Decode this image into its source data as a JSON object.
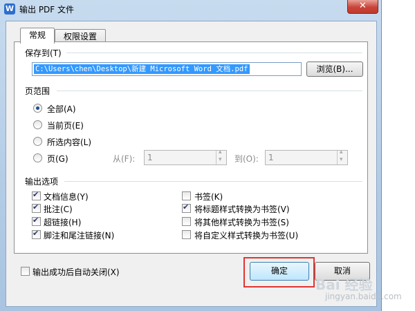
{
  "window": {
    "title": "输出 PDF 文件",
    "app_icon": "W",
    "close_glyph": "✕"
  },
  "tabs": [
    {
      "label": "常规"
    },
    {
      "label": "权限设置"
    }
  ],
  "save_to": {
    "label": "保存到(T)",
    "path": "C:\\Users\\chen\\Desktop\\新建 Microsoft Word 文档.pdf",
    "browse_label": "浏览(B)..."
  },
  "page_range": {
    "label": "页范围",
    "options": [
      {
        "label": "全部(A)",
        "checked": true
      },
      {
        "label": "当前页(E)",
        "checked": false
      },
      {
        "label": "所选内容(L)",
        "checked": false
      },
      {
        "label": "页(G)",
        "checked": false
      }
    ],
    "from_label": "从(F):",
    "from_value": "1",
    "to_label": "到(O):",
    "to_value": "1"
  },
  "output_options": {
    "label": "输出选项",
    "left": [
      {
        "label": "文档信息(Y)",
        "checked": true
      },
      {
        "label": "批注(C)",
        "checked": true
      },
      {
        "label": "超链接(H)",
        "checked": true
      },
      {
        "label": "脚注和尾注链接(N)",
        "checked": true
      }
    ],
    "right": [
      {
        "label": "书签(K)",
        "checked": false
      },
      {
        "label": "将标题样式转换为书签(V)",
        "checked": true
      },
      {
        "label": "将其他样式转换为书签(S)",
        "checked": false
      },
      {
        "label": "将自定义样式转换为书签(U)",
        "checked": false
      }
    ]
  },
  "auto_close": {
    "label": "输出成功后自动关闭(X)",
    "checked": false
  },
  "buttons": {
    "ok": "确定",
    "cancel": "取消"
  },
  "watermark": {
    "logo": "Bai 经验",
    "url": "jingyan.baidu.com"
  }
}
